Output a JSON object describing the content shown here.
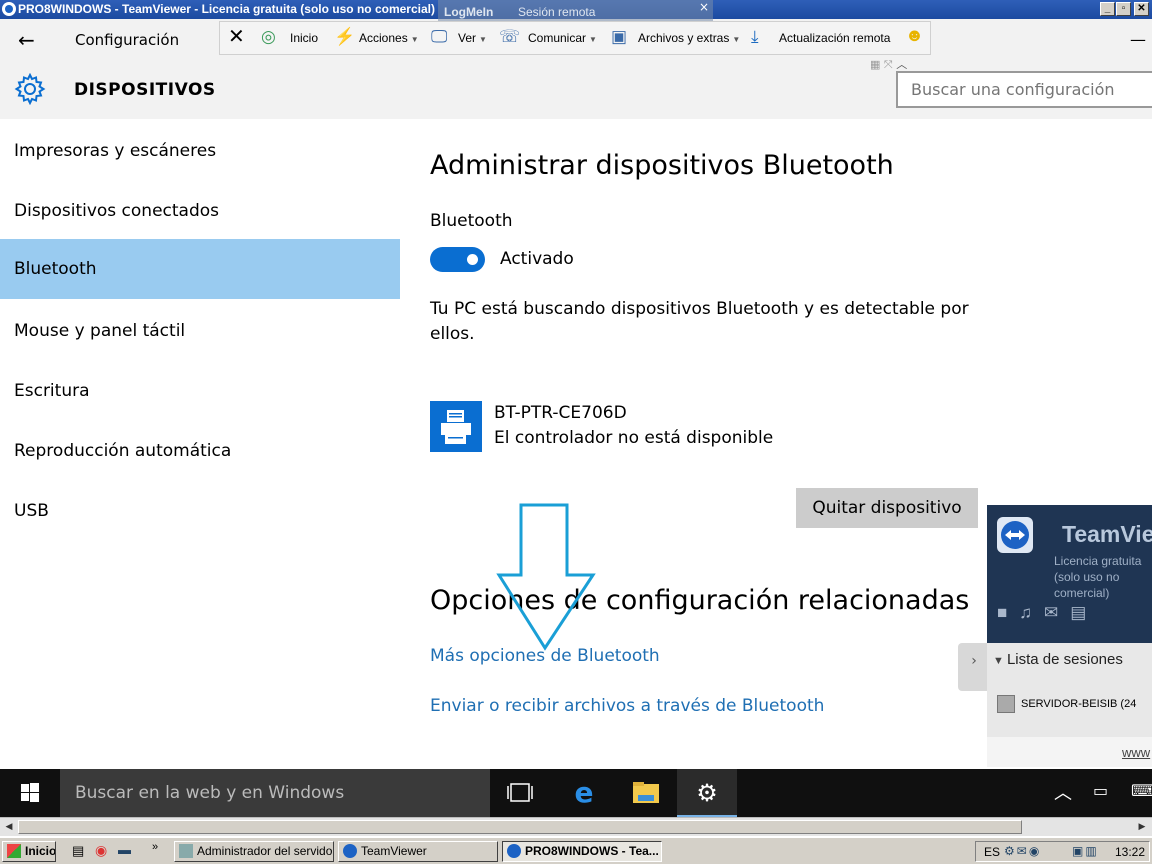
{
  "tv_window": {
    "title": "PRO8WINDOWS - TeamViewer - Licencia gratuita (solo uso no comercial)",
    "logmein_brand": "LogMeIn",
    "logmein_session": "Sesión remota",
    "logmein_close": "×",
    "btn_min": "_",
    "btn_max": "▫",
    "btn_close": "✕"
  },
  "tv_toolbar": {
    "items": [
      {
        "label": "Inicio"
      },
      {
        "label": "Acciones"
      },
      {
        "label": "Ver"
      },
      {
        "label": "Comunicar"
      },
      {
        "label": "Archivos y extras"
      },
      {
        "label": "Actualización remota"
      }
    ]
  },
  "settings": {
    "back": "←",
    "app_title": "Configuración",
    "section": "DISPOSITIVOS",
    "search_placeholder": "Buscar una configuración",
    "minimize": "—",
    "sidebar": [
      {
        "label": "Impresoras y escáneres",
        "selected": false
      },
      {
        "label": "Dispositivos conectados",
        "selected": false
      },
      {
        "label": "Bluetooth",
        "selected": true
      },
      {
        "label": "Mouse y panel táctil",
        "selected": false
      },
      {
        "label": "Escritura",
        "selected": false
      },
      {
        "label": "Reproducción automática",
        "selected": false
      },
      {
        "label": "USB",
        "selected": false
      }
    ],
    "main": {
      "title": "Administrar dispositivos Bluetooth",
      "bt_label": "Bluetooth",
      "toggle_state": "Activado",
      "toggle_on": true,
      "discover_text": "Tu PC está buscando dispositivos Bluetooth y es detectable por ellos.",
      "device_name": "BT-PTR-CE706D",
      "device_status": "El controlador no está disponible",
      "remove_button": "Quitar dispositivo",
      "related_title": "Opciones de configuración relacionadas",
      "links": [
        "Más opciones de Bluetooth",
        "Enviar o recibir archivos a través de Bluetooth"
      ]
    }
  },
  "tv_panel": {
    "name": "TeamViewer",
    "license": "Licencia gratuita (solo uso no comercial)",
    "sessions_header": "Lista de sesiones",
    "session_item": "SERVIDOR-BEISIB (24",
    "footer_link": "www"
  },
  "w10_taskbar": {
    "search_placeholder": "Buscar en la web y en Windows"
  },
  "xp_taskbar": {
    "start": "Inicio",
    "buttons": [
      "Administrador del servidor",
      "TeamViewer",
      "PRO8WINDOWS - Tea..."
    ],
    "lang": "ES",
    "clock": "13:22"
  },
  "colors": {
    "accent": "#0a6ed1",
    "sidebar_selected": "#99cbf0",
    "link": "#1f6fb3",
    "arrow": "#1a9fd6"
  }
}
